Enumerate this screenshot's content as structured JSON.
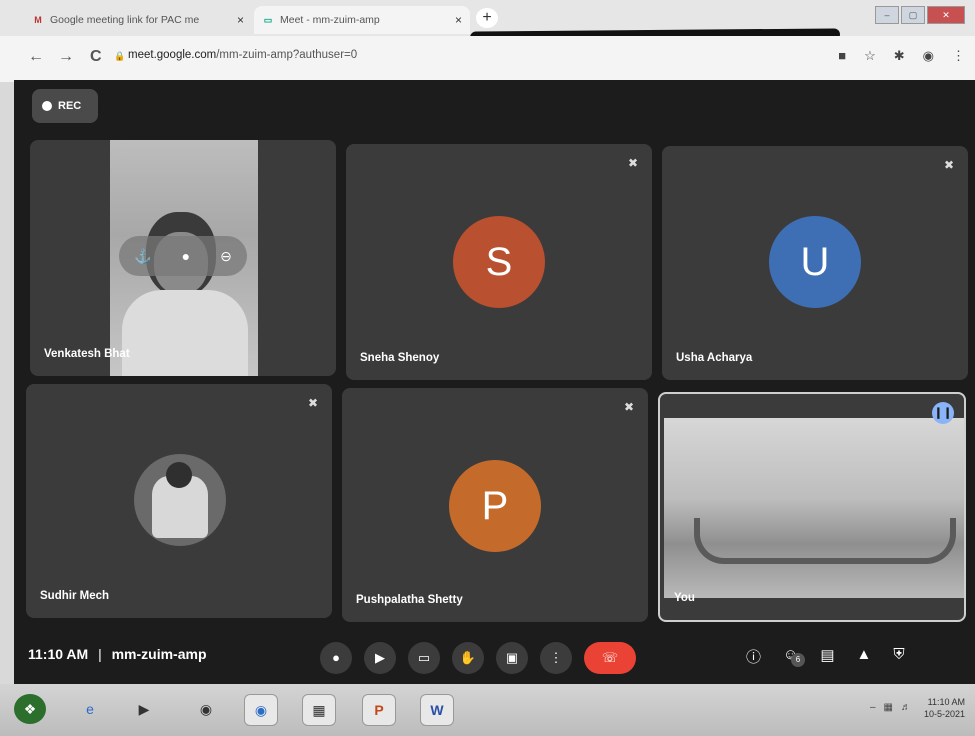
{
  "browser": {
    "tabs": [
      {
        "favicon": "M",
        "label": "Google meeting link for PAC me",
        "close": "×"
      },
      {
        "favicon": "▭",
        "label": "Meet - mm-zuim-amp",
        "close": "×"
      }
    ],
    "new_tab": "+",
    "nav": {
      "back": "←",
      "forward": "→",
      "reload": "C"
    },
    "url_host": "meet.google.com",
    "url_path": "/mm-zuim-amp?authuser=0",
    "window_controls": [
      "–",
      "▢",
      "✕"
    ]
  },
  "meet": {
    "rec_label": "REC",
    "participants": [
      {
        "name": "Venkatesh Bhat",
        "type": "video"
      },
      {
        "name": "Sneha Shenoy",
        "initial": "S",
        "avatar_color": "#b9502f",
        "muted": true
      },
      {
        "name": "Usha Acharya",
        "initial": "U",
        "avatar_color": "#3e6fb5",
        "muted": true
      },
      {
        "name": "Sudhir Mech",
        "type": "photo",
        "muted": true
      },
      {
        "name": "Pushpalatha Shetty",
        "initial": "P",
        "avatar_color": "#c46b2c",
        "muted": true
      },
      {
        "name": "You",
        "type": "room"
      }
    ],
    "time": "11:10 AM",
    "separator": "|",
    "meeting_code": "mm-zuim-amp",
    "people_count": "6"
  },
  "taskbar": {
    "time": "11:10 AM",
    "date": "10-5-2021"
  },
  "colors": {
    "meet_bg": "#1c1c1c",
    "tile_bg": "#3b3b3b",
    "end_call": "#ea4335",
    "speaking": "#8ab4f8"
  }
}
